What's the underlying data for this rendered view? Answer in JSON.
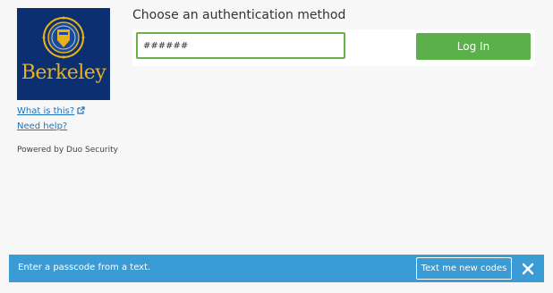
{
  "sidebar": {
    "logo_text": "Berkeley",
    "what_is_this": "What is this?",
    "need_help": "Need help?",
    "powered_by": "Powered by Duo Security"
  },
  "main": {
    "heading": "Choose an authentication method",
    "passcode_value": "######",
    "login_label": "Log In"
  },
  "notification": {
    "message": "Enter a passcode from a text.",
    "button_label": "Text me new codes"
  },
  "colors": {
    "logo_bg": "#0b2f70",
    "logo_gold": "#e9b21b",
    "link": "#1f73bd",
    "login_green": "#5cb04b",
    "input_border": "#6ab04c",
    "notice_blue": "#3b9bd4"
  },
  "icons": {
    "external_link": "external-link-icon",
    "close": "close-icon",
    "seal": "uc-seal-icon"
  }
}
